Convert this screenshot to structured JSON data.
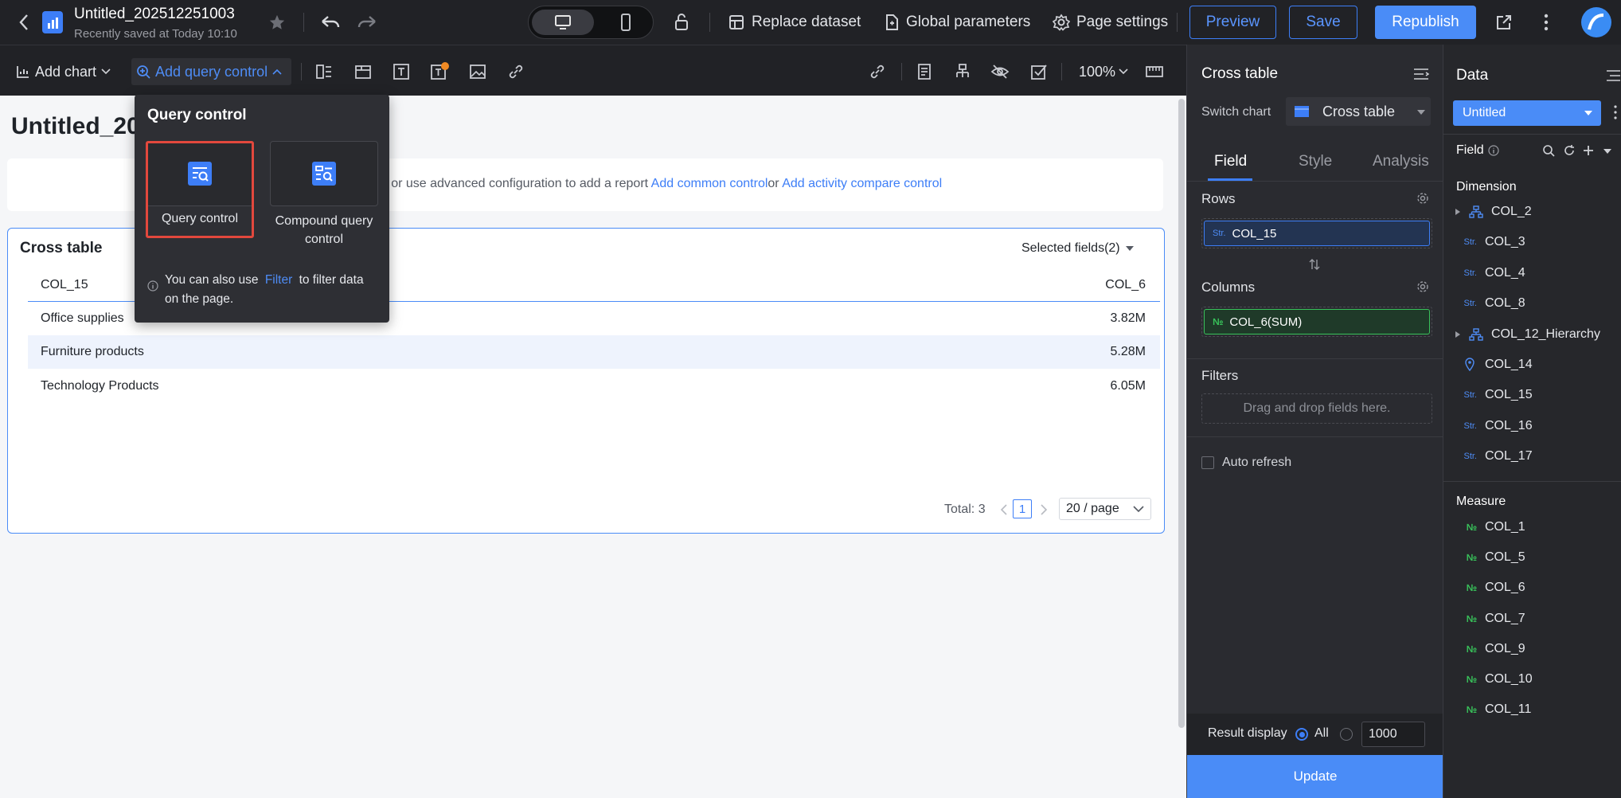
{
  "header": {
    "title": "Untitled_202512251003",
    "subtitle": "Recently saved at Today 10:10",
    "replace_dataset": "Replace dataset",
    "global_parameters": "Global parameters",
    "page_settings": "Page settings",
    "preview": "Preview",
    "save": "Save",
    "republish": "Republish"
  },
  "toolbar": {
    "add_chart": "Add chart",
    "add_query_control": "Add query control",
    "zoom": "100%"
  },
  "canvas": {
    "title": "Untitled_20",
    "hint_text": "rt or use advanced configuration to add a report",
    "add_common_control": "Add common control",
    "or": "or",
    "add_activity_compare_control": "Add activity compare control"
  },
  "cross_table": {
    "title": "Cross table",
    "selected_fields": "Selected fields(2)",
    "columns": [
      "COL_15",
      "COL_6"
    ],
    "rows": [
      [
        "Office supplies",
        "3.82M"
      ],
      [
        "Furniture products",
        "5.28M"
      ],
      [
        "Technology Products",
        "6.05M"
      ]
    ],
    "total": "Total: 3",
    "page": "1",
    "page_size": "20 / page"
  },
  "query_popup": {
    "title": "Query control",
    "tile1": "Query control",
    "tile2": "Compound query control",
    "note_a": "You can also use",
    "filter_link": "Filter",
    "note_b": "to filter data",
    "note_c": "on the page."
  },
  "config": {
    "title": "Cross table",
    "switch_chart_label": "Switch chart",
    "switch_chart_value": "Cross table",
    "tabs": [
      "Field",
      "Style",
      "Analysis"
    ],
    "rows_label": "Rows",
    "rows_field": "COL_15",
    "columns_label": "Columns",
    "columns_field": "COL_6(SUM)",
    "filters_label": "Filters",
    "filters_placeholder": "Drag and drop fields here.",
    "auto_refresh": "Auto refresh",
    "result_display": "Result display",
    "all": "All",
    "limit": "1000",
    "update": "Update"
  },
  "data_panel": {
    "title": "Data",
    "dataset": "Untitled",
    "field_label": "Field",
    "dimension_label": "Dimension",
    "measure_label": "Measure",
    "dimensions": [
      {
        "name": "COL_2",
        "type": "hier"
      },
      {
        "name": "COL_3",
        "type": "str"
      },
      {
        "name": "COL_4",
        "type": "str"
      },
      {
        "name": "COL_8",
        "type": "str"
      },
      {
        "name": "COL_12_Hierarchy",
        "type": "hier"
      },
      {
        "name": "COL_14",
        "type": "geo"
      },
      {
        "name": "COL_15",
        "type": "str"
      },
      {
        "name": "COL_16",
        "type": "str"
      },
      {
        "name": "COL_17",
        "type": "str"
      }
    ],
    "measures": [
      "COL_1",
      "COL_5",
      "COL_6",
      "COL_7",
      "COL_9",
      "COL_10",
      "COL_11"
    ],
    "str_tag": "Str.",
    "num_tag": "№"
  },
  "colors": {
    "accent": "#3d7ef7",
    "highlight_border": "#e2483d",
    "dimension": "#4e8cf5",
    "measure": "#38c25a"
  }
}
